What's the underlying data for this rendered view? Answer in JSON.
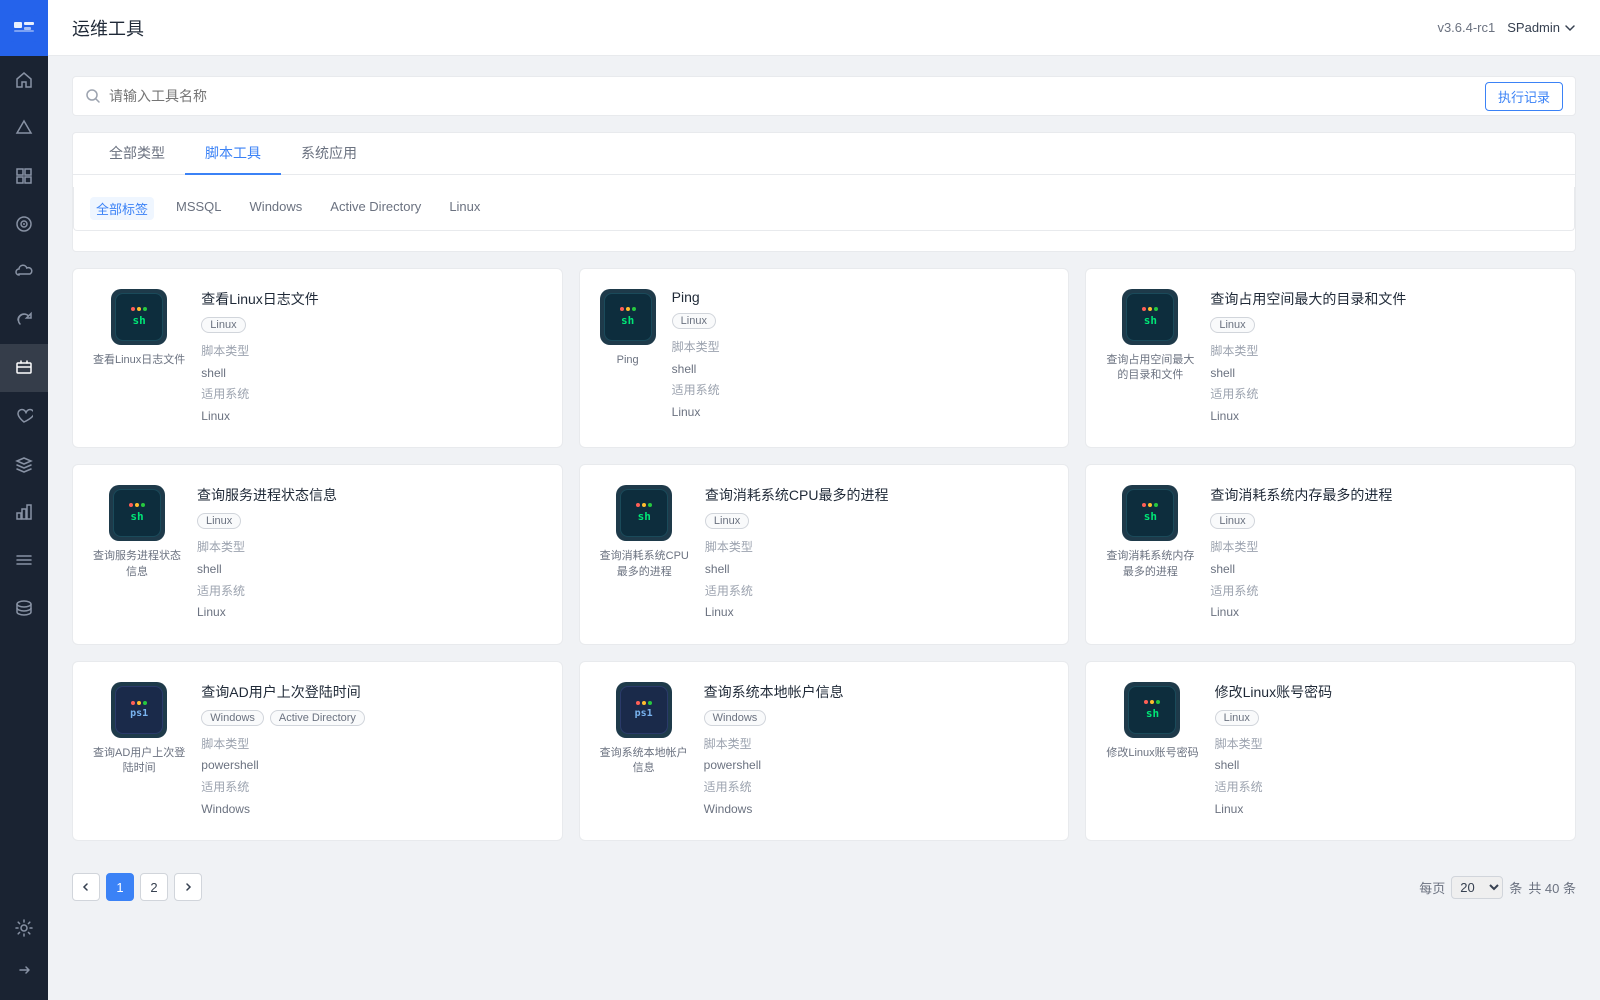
{
  "app": {
    "title": "运维工具",
    "version": "v3.6.4-rc1",
    "user": "SPadmin"
  },
  "search": {
    "placeholder": "请输入工具名称",
    "exec_record_label": "执行记录"
  },
  "tabs": [
    {
      "id": "all",
      "label": "全部类型",
      "active": false
    },
    {
      "id": "script",
      "label": "脚本工具",
      "active": true
    },
    {
      "id": "sysapp",
      "label": "系统应用",
      "active": false
    }
  ],
  "tag_filters": [
    {
      "id": "all",
      "label": "全部标签",
      "active": true
    },
    {
      "id": "mssql",
      "label": "MSSQL",
      "active": false
    },
    {
      "id": "windows",
      "label": "Windows",
      "active": false
    },
    {
      "id": "ad",
      "label": "Active Directory",
      "active": false
    },
    {
      "id": "linux",
      "label": "Linux",
      "active": false
    }
  ],
  "cards": [
    {
      "id": "c1",
      "title": "查看Linux日志文件",
      "tags": [
        "Linux"
      ],
      "script_type_label": "脚本类型",
      "script_type_value": "shell",
      "os_label": "适用系统",
      "os_value": "Linux",
      "icon_text": "sh",
      "icon_color": "sh"
    },
    {
      "id": "c2",
      "title": "Ping",
      "tags": [
        "Linux"
      ],
      "script_type_label": "脚本类型",
      "script_type_value": "shell",
      "os_label": "适用系统",
      "os_value": "Linux",
      "icon_text": "sh",
      "icon_color": "sh"
    },
    {
      "id": "c3",
      "title": "查询占用空间最大的目录和文件",
      "tags": [
        "Linux"
      ],
      "script_type_label": "脚本类型",
      "script_type_value": "shell",
      "os_label": "适用系统",
      "os_value": "Linux",
      "icon_text": "sh",
      "icon_color": "sh"
    },
    {
      "id": "c4",
      "title": "查询服务进程状态信息",
      "tags": [
        "Linux"
      ],
      "script_type_label": "脚本类型",
      "script_type_value": "shell",
      "os_label": "适用系统",
      "os_value": "Linux",
      "icon_text": "sh",
      "icon_color": "sh"
    },
    {
      "id": "c5",
      "title": "查询消耗系统CPU最多的进程",
      "tags": [
        "Linux"
      ],
      "script_type_label": "脚本类型",
      "script_type_value": "shell",
      "os_label": "适用系统",
      "os_value": "Linux",
      "icon_text": "sh",
      "icon_color": "sh"
    },
    {
      "id": "c6",
      "title": "查询消耗系统内存最多的进程",
      "tags": [
        "Linux"
      ],
      "script_type_label": "脚本类型",
      "script_type_value": "shell",
      "os_label": "适用系统",
      "os_value": "Linux",
      "icon_text": "sh",
      "icon_color": "sh"
    },
    {
      "id": "c7",
      "title": "查询AD用户上次登陆时间",
      "tags": [
        "Windows",
        "Active Directory"
      ],
      "script_type_label": "脚本类型",
      "script_type_value": "powershell",
      "os_label": "适用系统",
      "os_value": "Windows",
      "icon_text": "ps1",
      "icon_color": "ps1"
    },
    {
      "id": "c8",
      "title": "查询系统本地帐户信息",
      "tags": [
        "Windows"
      ],
      "script_type_label": "脚本类型",
      "script_type_value": "powershell",
      "os_label": "适用系统",
      "os_value": "Windows",
      "icon_text": "ps1",
      "icon_color": "ps1"
    },
    {
      "id": "c9",
      "title": "修改Linux账号密码",
      "tags": [
        "Linux"
      ],
      "script_type_label": "脚本类型",
      "script_type_value": "shell",
      "os_label": "适用系统",
      "os_value": "Linux",
      "icon_text": "sh",
      "icon_color": "sh"
    }
  ],
  "pagination": {
    "current_page": 1,
    "total_pages": 2,
    "page_size": 20,
    "total_count": 40,
    "per_page_label": "每页",
    "count_label": "条",
    "total_label": "共",
    "total_count_label": "条"
  },
  "sidebar": {
    "items": [
      {
        "id": "home",
        "icon": "⌂",
        "active": false
      },
      {
        "id": "monitor",
        "icon": "▲",
        "active": false
      },
      {
        "id": "grid",
        "icon": "⊞",
        "active": false
      },
      {
        "id": "target",
        "icon": "◎",
        "active": false
      },
      {
        "id": "cloud",
        "icon": "☁",
        "active": false
      },
      {
        "id": "refresh",
        "icon": "↺",
        "active": false
      },
      {
        "id": "tools",
        "icon": "🔧",
        "active": true
      },
      {
        "id": "heart",
        "icon": "♡",
        "active": false
      },
      {
        "id": "layers",
        "icon": "≡",
        "active": false
      },
      {
        "id": "chart",
        "icon": "▦",
        "active": false
      },
      {
        "id": "list",
        "icon": "☰",
        "active": false
      },
      {
        "id": "storage",
        "icon": "▭",
        "active": false
      },
      {
        "id": "settings",
        "icon": "⚙",
        "active": false
      }
    ],
    "expand_icon": "→|"
  }
}
